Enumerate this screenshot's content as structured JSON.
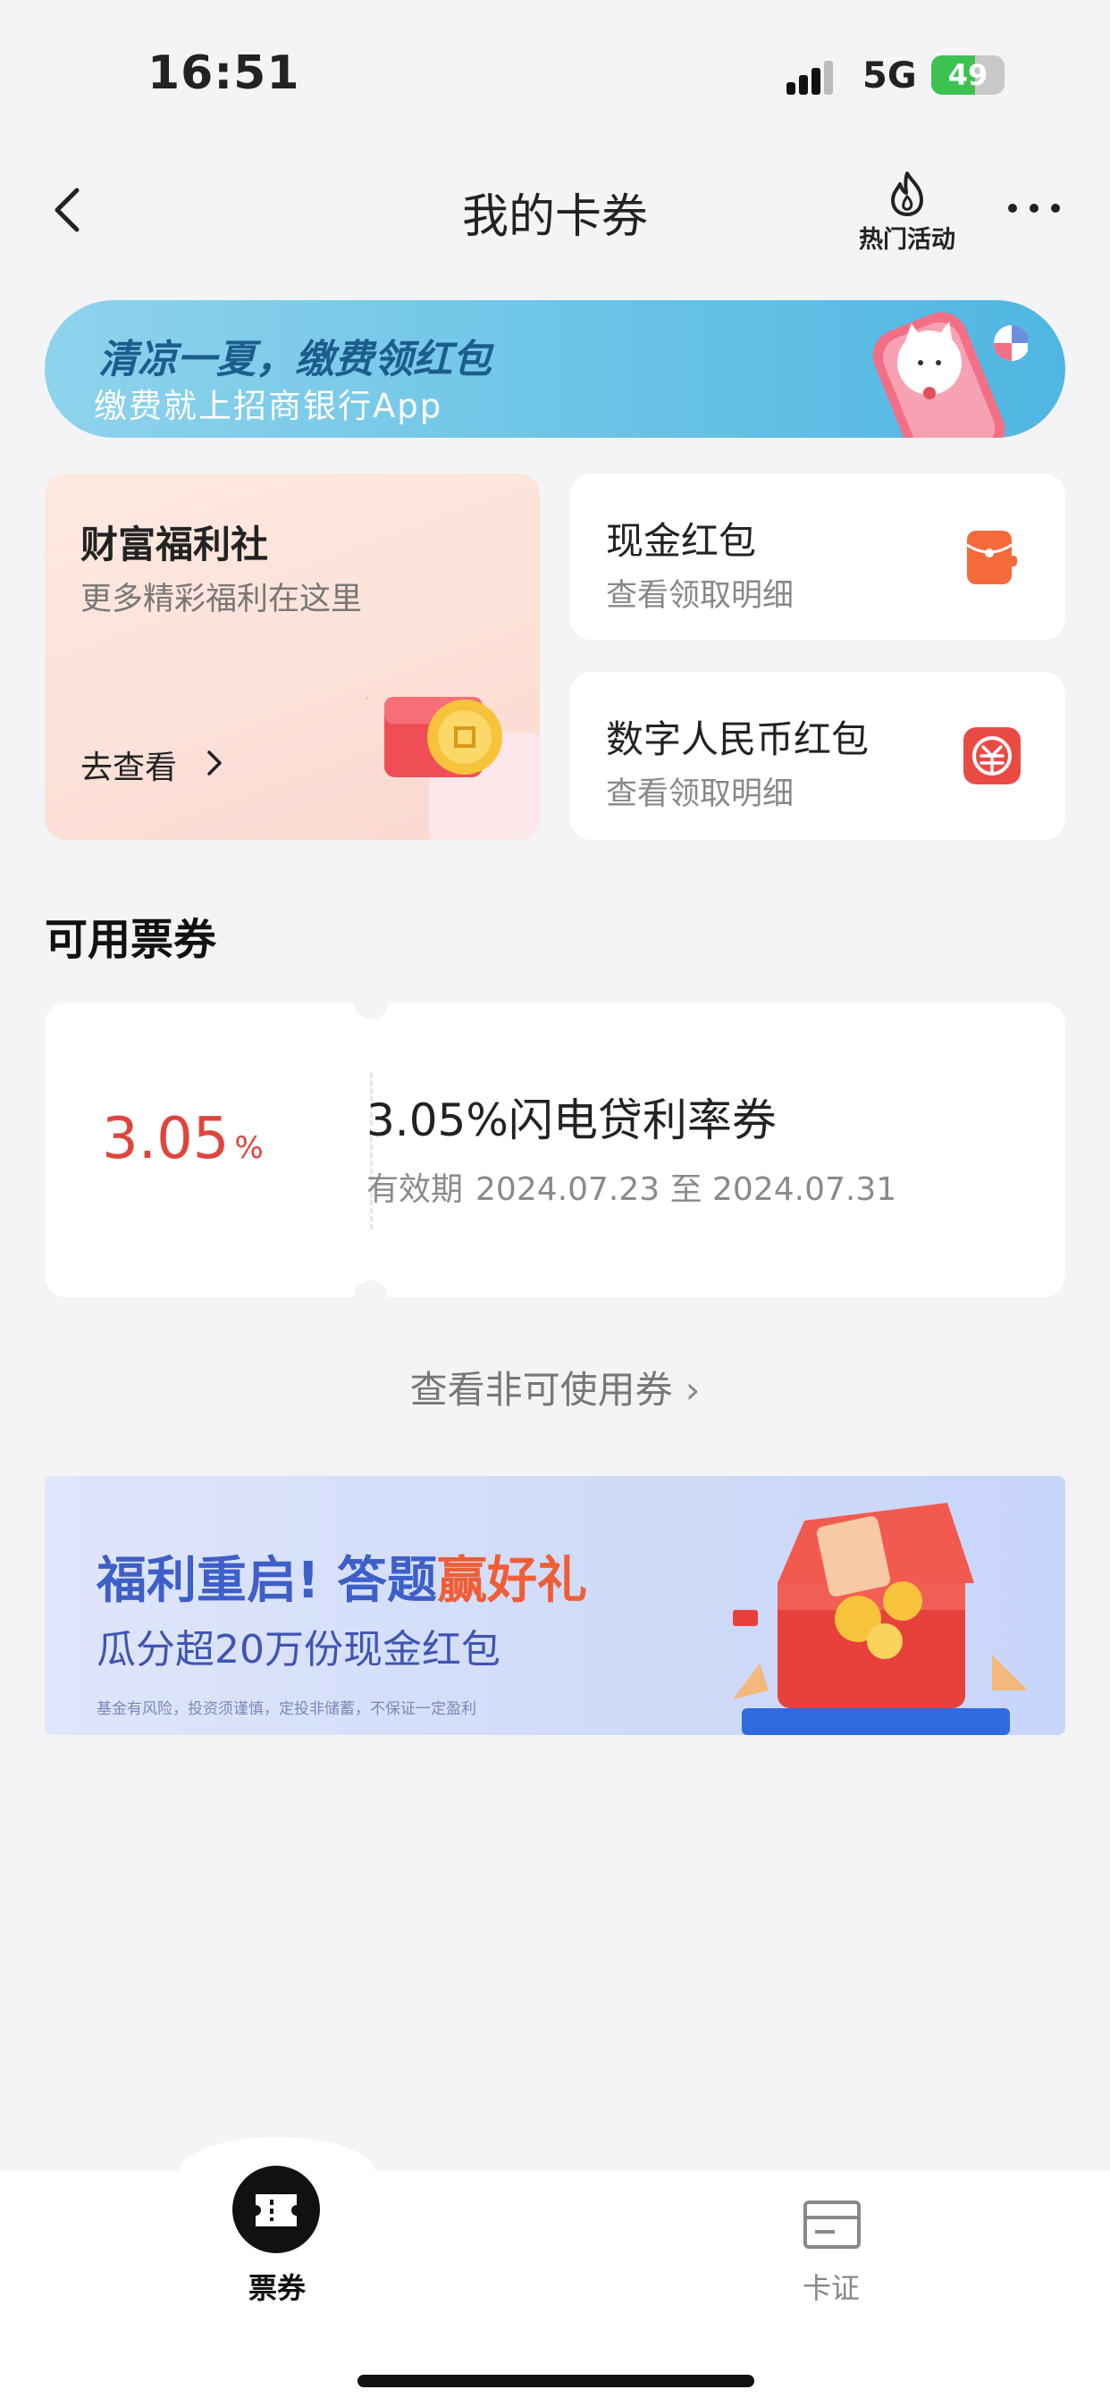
{
  "status_bar": {
    "time": "16:51",
    "network": "5G",
    "battery_level": "49"
  },
  "nav": {
    "title": "我的卡券",
    "hot_label": "热门活动"
  },
  "banner_top": {
    "line1": "清凉一夏，缴费领红包",
    "line2": "缴费就上招商银行App"
  },
  "wealth_card": {
    "title": "财富福利社",
    "subtitle": "更多精彩福利在这里",
    "link": "去查看"
  },
  "cash_card": {
    "title": "现金红包",
    "subtitle": "查看领取明细"
  },
  "rmb_card": {
    "title": "数字人民币红包",
    "subtitle": "查看领取明细"
  },
  "section_title": "可用票券",
  "coupon": {
    "rate": "3.05",
    "rate_unit": "%",
    "title": "3.05%闪电贷利率券",
    "valid_label": "有效期",
    "valid_range": "2024.07.23 至 2024.07.31"
  },
  "unavailable_link": "查看非可使用券",
  "banner_bottom": {
    "line1_part1": "福利重启! 答题",
    "line1_part2": "赢好礼",
    "line2": "瓜分超20万份现金红包",
    "disclaimer": "基金有风险，投资须谨慎，定投非储蓄，不保证一定盈利"
  },
  "tabs": [
    {
      "label": "票券",
      "active": true
    },
    {
      "label": "卡证",
      "active": false
    }
  ],
  "colors": {
    "accent_red": "#e0443e",
    "cash_icon": "#f46a3a",
    "rmb_icon": "#ea4a44",
    "banner_blue": "#3d5fc8"
  }
}
